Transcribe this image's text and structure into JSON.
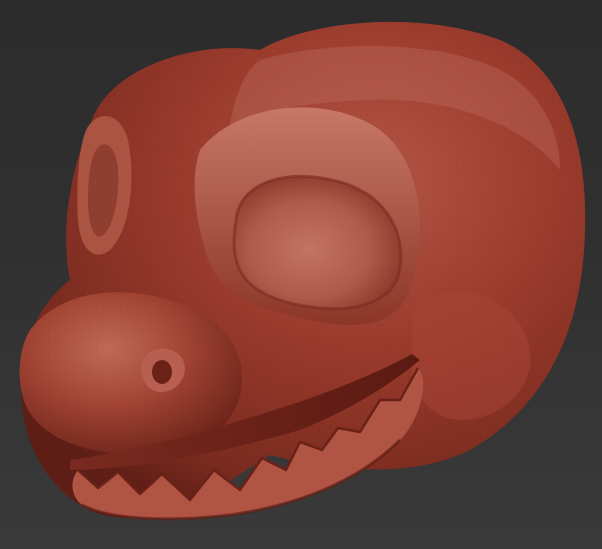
{
  "scene": {
    "subject": "clay-sculpt-creature-head",
    "icons": [
      "creature-head-render"
    ],
    "colors": {
      "background_top": "#2c2c2c",
      "background_bottom": "#3a3a3a",
      "clay_base": "#9a3b2c",
      "clay_shadow": "#5e1e16",
      "clay_highlight": "#c4705e",
      "eye_socket": "#b05a4a",
      "mouth_dark": "#6a2218",
      "teeth": "#b8584a"
    }
  }
}
